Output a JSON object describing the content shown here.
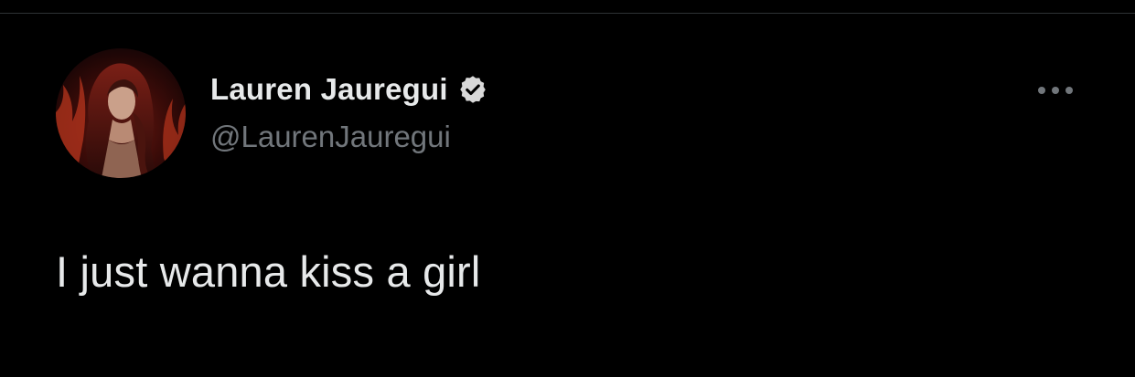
{
  "tweet": {
    "author": {
      "display_name": "Lauren Jauregui",
      "handle": "@LaurenJauregui",
      "verified": true,
      "avatar_icon": "profile-photo"
    },
    "text": "I just wanna kiss a girl",
    "menu_icon": "more-horizontal-icon",
    "verified_icon": "verified-badge-icon"
  },
  "colors": {
    "background": "#000000",
    "primary_text": "#e7e9ea",
    "secondary_text": "#71767b",
    "divider": "#2f3336"
  }
}
